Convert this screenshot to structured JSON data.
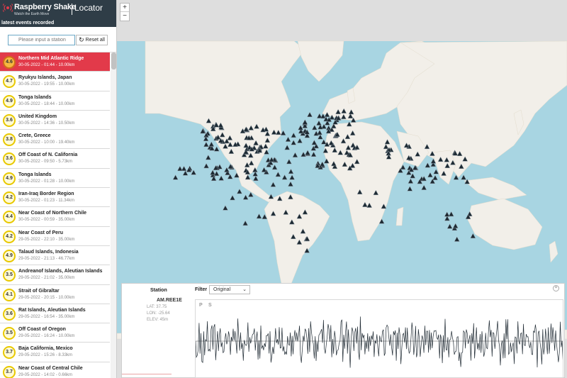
{
  "brand": {
    "name": "Raspberry Shake",
    "tagline": "Watch the Earth Move",
    "app_name": "Locator"
  },
  "sidebar": {
    "header": "latest events recorded",
    "station_placeholder": "Please input a station",
    "reset_label": "Reset all",
    "events": [
      {
        "mag": "4.6",
        "name": "Northern Mid Atlantic Ridge",
        "meta": "30-05-2022 - 01:44 - 10.00km",
        "selected": true
      },
      {
        "mag": "4.7",
        "name": "Ryukyu Islands, Japan",
        "meta": "30-05-2022 - 19:55 - 10.00km"
      },
      {
        "mag": "4.9",
        "name": "Tonga Islands",
        "meta": "30-05-2022 - 18:44 - 10.00km"
      },
      {
        "mag": "3.6",
        "name": "United Kingdom",
        "meta": "30-05-2022 - 14:36 - 10.50km"
      },
      {
        "mag": "3.8",
        "name": "Crete, Greece",
        "meta": "30-05-2022 - 10:00 - 19.40km"
      },
      {
        "mag": "3.6",
        "name": "Off Coast of N. California",
        "meta": "30-05-2022 - 09:50 - 5.73km"
      },
      {
        "mag": "4.9",
        "name": "Tonga Islands",
        "meta": "30-05-2022 - 01:28 - 10.00km"
      },
      {
        "mag": "4.2",
        "name": "Iran-Iraq Border Region",
        "meta": "30-05-2022 - 01:23 - 11.34km"
      },
      {
        "mag": "4.4",
        "name": "Near Coast of Northern Chile",
        "meta": "30-05-2022 - 00:59 - 35.00km"
      },
      {
        "mag": "4.2",
        "name": "Near Coast of Peru",
        "meta": "29-05-2022 - 22:10 - 35.00km"
      },
      {
        "mag": "4.9",
        "name": "Talaud Islands, Indonesia",
        "meta": "29-05-2022 - 21:13 - 46.77km"
      },
      {
        "mag": "3.5",
        "name": "Andreanof Islands, Aleutian Islands",
        "meta": "29-05-2022 - 21:02 - 35.00km"
      },
      {
        "mag": "4.1",
        "name": "Strait of Gibraltar",
        "meta": "29-05-2022 - 20:15 - 10.00km"
      },
      {
        "mag": "3.6",
        "name": "Rat Islands, Aleutian Islands",
        "meta": "29-05-2022 - 16:54 - 35.00km"
      },
      {
        "mag": "3.5",
        "name": "Off Coast of Oregon",
        "meta": "29-05-2022 - 16:24 - 10.00km"
      },
      {
        "mag": "3.7",
        "name": "Baja California, Mexico",
        "meta": "29-05-2022 - 15:26 - 8.33km"
      },
      {
        "mag": "3.7",
        "name": "Near Coast of Central Chile",
        "meta": "29-05-2022 - 14:02 - 0.66km"
      }
    ]
  },
  "map": {
    "zoom_in": "+",
    "zoom_out": "−",
    "ocean_color": "#a8d5e2",
    "land_color": "#f2efe9",
    "marker_color": "#1d2a33"
  },
  "station_panel": {
    "station_heading": "Station",
    "station_code": "AM.REE1E",
    "lat": "LAT: 37.75",
    "lon": "LON: -25.64",
    "elev": "ELEV: 45m",
    "filter_label": "Filter",
    "filter_value": "Original",
    "phase_p": "P",
    "phase_s": "S"
  }
}
